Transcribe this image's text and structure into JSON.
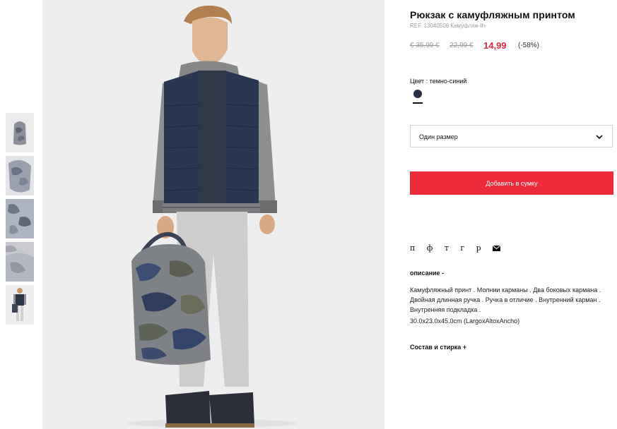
{
  "product": {
    "title": "Рюкзак с камуфляжным принтом",
    "ref": "REF. 13040506 Камуфляж-Ih-",
    "prices": {
      "old1": "€ 35,99 €",
      "old2": "22,99 €",
      "current": "14,99",
      "discount": "(-58%)",
      "accent_color": "#e02938"
    },
    "color_label": "Цвет : темно-синий",
    "swatch_color": "#2b2f45",
    "size_label": "Один размер",
    "add_button": "Добавить в сумку",
    "share": {
      "icons": [
        {
          "name": "pinterest",
          "glyph": "п"
        },
        {
          "name": "facebook",
          "glyph": "ф"
        },
        {
          "name": "twitter",
          "glyph": "т"
        },
        {
          "name": "google-plus",
          "glyph": "г"
        },
        {
          "name": "print",
          "glyph": "р"
        },
        {
          "name": "mail",
          "glyph": "mail-icon"
        }
      ]
    },
    "description": {
      "heading": "описание -",
      "text": "Камуфляжный принт . Молнии карманы . Два боковых кармана . Двойная длинная ручка . Ручка в отличие . Внутренний карман . Внутренняя подкладка .",
      "dimensions": "30.0x23.0x45.0cm (LargoxAltoxAncho)"
    },
    "composition": "Состав и стирка +"
  },
  "gallery": {
    "thumbnails": [
      "thumbnail-1",
      "thumbnail-2",
      "thumbnail-3",
      "thumbnail-4",
      "thumbnail-5"
    ]
  }
}
